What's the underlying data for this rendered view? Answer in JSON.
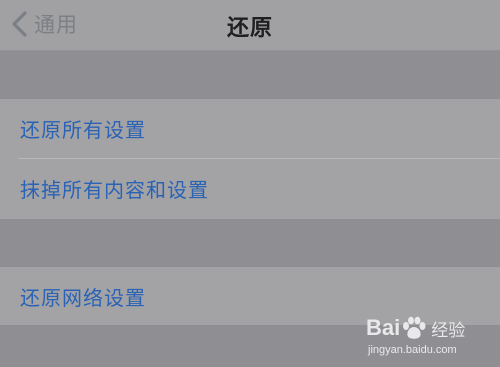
{
  "nav": {
    "back_label": "通用",
    "title": "还原"
  },
  "group_one": {
    "items": [
      {
        "label": "还原所有设置"
      },
      {
        "label": "抹掉所有内容和设置"
      }
    ]
  },
  "group_two": {
    "items": [
      {
        "label": "还原网络设置"
      }
    ]
  },
  "watermark": {
    "brand_left": "Bai",
    "brand_right": "经验",
    "url": "jingyan.baidu.com"
  },
  "colors": {
    "background": "#8f8f93",
    "cell_background": "#a3a3a5",
    "nav_background": "#a1a1a3",
    "link_text": "#2a63b6",
    "title_text": "#1f1f21",
    "back_text": "#7b7f86"
  },
  "icons": {
    "back": "chevron-left-icon",
    "watermark": "baidu-paw-icon"
  }
}
